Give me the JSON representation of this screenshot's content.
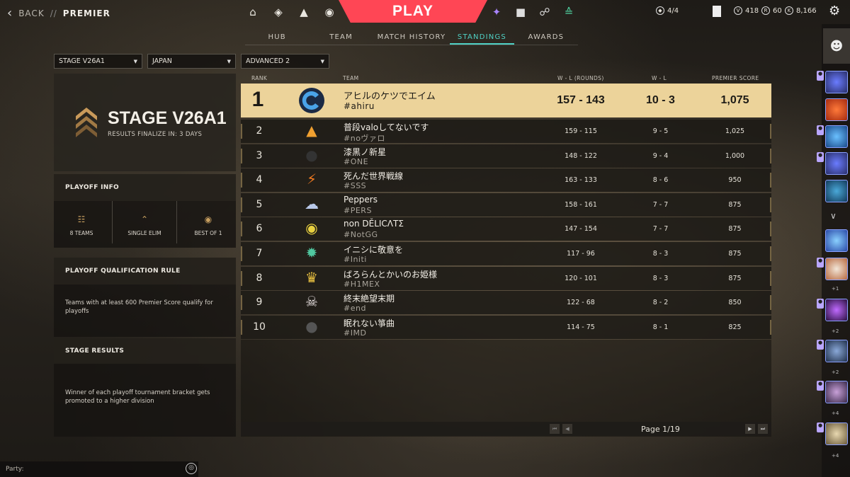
{
  "header": {
    "back_label": "BACK",
    "separator": "//",
    "title": "PREMIER",
    "play_label": "PLAY",
    "currencies": [
      {
        "icon": "competitive-icon",
        "value": "4/4"
      },
      {
        "icon": "valorant-points-icon",
        "value": "418"
      },
      {
        "icon": "radianite-icon",
        "value": "60"
      },
      {
        "icon": "kingdom-credits-icon",
        "value": "8,166"
      }
    ]
  },
  "tabs": [
    {
      "label": "HUB",
      "active": false
    },
    {
      "label": "TEAM",
      "active": false
    },
    {
      "label": "MATCH HISTORY",
      "active": false
    },
    {
      "label": "STANDINGS",
      "active": true
    },
    {
      "label": "AWARDS",
      "active": false
    }
  ],
  "filters": {
    "stage": "STAGE V26A1",
    "region": "JAPAN",
    "division": "ADVANCED 2"
  },
  "stage": {
    "name": "STAGE V26A1",
    "finalize": "RESULTS FINALIZE IN: 3 DAYS"
  },
  "playoff_info": {
    "heading": "PLAYOFF INFO",
    "teams": "8 TEAMS",
    "format": "SINGLE ELIM",
    "series": "BEST OF 1"
  },
  "qualification": {
    "heading": "PLAYOFF QUALIFICATION RULE",
    "text": "Teams with at least 600 Premier Score qualify for playoffs"
  },
  "stage_results": {
    "heading": "STAGE RESULTS",
    "text": "Winner of each playoff tournament bracket gets promoted to a higher division"
  },
  "table": {
    "headers": {
      "rank": "RANK",
      "team": "TEAM",
      "wlr": "W - L (ROUNDS)",
      "wl": "W - L",
      "score": "PREMIER SCORE"
    },
    "rows": [
      {
        "rank": "1",
        "name": "アヒルのケツでエイム",
        "tag": "#ahiru",
        "wlr": "157 - 143",
        "wl": "10 - 3",
        "score": "1,075",
        "emblem": "blue-swirl-emblem"
      },
      {
        "rank": "2",
        "name": "普段valoしてないです",
        "tag": "#noヴァロ",
        "wlr": "159 - 115",
        "wl": "9 - 5",
        "score": "1,025",
        "emblem": "fire-hat-emblem"
      },
      {
        "rank": "3",
        "name": "漆黒ノ新星",
        "tag": "#ONE",
        "wlr": "148 - 122",
        "wl": "9 - 4",
        "score": "1,000",
        "emblem": "black-cat-emblem"
      },
      {
        "rank": "4",
        "name": "死んだ世界戦線",
        "tag": "#SSS",
        "wlr": "163 - 133",
        "wl": "8 - 6",
        "score": "950",
        "emblem": "lightning-emblem"
      },
      {
        "rank": "5",
        "name": "Peppers",
        "tag": "#PERS",
        "wlr": "158 - 161",
        "wl": "7 - 7",
        "score": "875",
        "emblem": "ghost-emblem"
      },
      {
        "rank": "6",
        "name": "non DĚLICΛTΣ",
        "tag": "#NotGG",
        "wlr": "147 - 154",
        "wl": "7 - 7",
        "score": "875",
        "emblem": "masked-face-emblem"
      },
      {
        "rank": "7",
        "name": "イニシに敬意を",
        "tag": "#Initi",
        "wlr": "117 - 96",
        "wl": "8 - 3",
        "score": "875",
        "emblem": "spiky-creature-emblem"
      },
      {
        "rank": "8",
        "name": "ばろらんとかいのお姫様",
        "tag": "#H1MEX",
        "wlr": "120 - 101",
        "wl": "8 - 3",
        "score": "875",
        "emblem": "crown-emblem"
      },
      {
        "rank": "9",
        "name": "終末絶望末期",
        "tag": "#end",
        "wlr": "122 - 68",
        "wl": "8 - 2",
        "score": "850",
        "emblem": "skull-panda-emblem"
      },
      {
        "rank": "10",
        "name": "眠れない箏曲",
        "tag": "#IMD",
        "wlr": "114 - 75",
        "wl": "8 - 1",
        "score": "825",
        "emblem": "dark-cat-emblem"
      }
    ]
  },
  "pagination": {
    "label": "Page 1/19"
  },
  "party": {
    "label": "Party:"
  },
  "social": {
    "counts": [
      "+1",
      "+2",
      "+2",
      "+4",
      "+4"
    ]
  },
  "colors": {
    "accent": "#ff4655",
    "tab_active": "#4fd1c5",
    "gold": "#ecd39a"
  }
}
